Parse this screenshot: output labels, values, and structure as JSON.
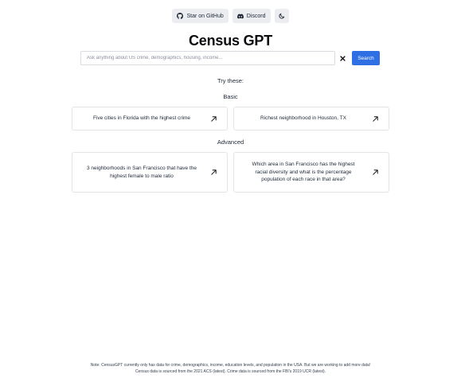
{
  "header": {
    "github_label": "Star on GitHub",
    "discord_label": "Discord"
  },
  "app": {
    "title": "Census GPT"
  },
  "search": {
    "placeholder": "Ask anything about US crime, demographics, housing, income...",
    "value": "",
    "button_label": "Search"
  },
  "suggestions": {
    "heading": "Try these:",
    "basic": {
      "label": "Basic",
      "items": [
        "Five cities in Florida with the highest crime",
        "Richest neighborhood in Houston, TX"
      ]
    },
    "advanced": {
      "label": "Advanced",
      "items": [
        "3 neighborhoods in San Francisco that have the highest female to male ratio",
        "Which area in San Francisco has the highest racial diversity and what is the percentage population of each race in that area?"
      ]
    }
  },
  "footer": {
    "line1": "Note: CensusGPT currently only has data for crime, demographics, income, education levels, and population in the USA. But we are working to add more data!",
    "line2": "Census data is sourced from the 2021 ACS (latest). Crime data is sourced from the FBI's 2019 UCR (latest)."
  },
  "icons": {
    "github": "github-icon",
    "discord": "discord-icon",
    "theme": "moon-icon",
    "clear": "close-icon",
    "arrow": "arrow-up-right-icon"
  },
  "colors": {
    "accent": "#2f6fe4",
    "pill_bg": "#ebedf0",
    "card_border": "#e2e4e8"
  }
}
